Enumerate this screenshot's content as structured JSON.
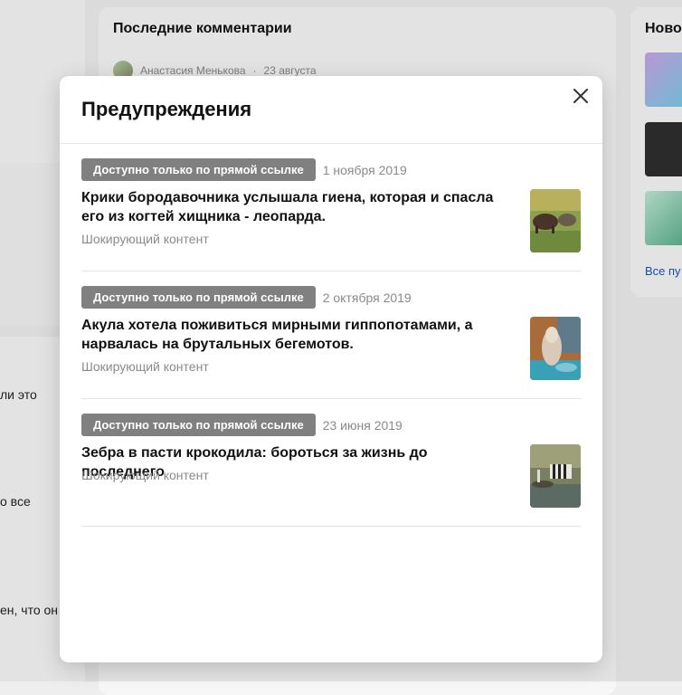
{
  "background": {
    "center_title": "Последние комментарии",
    "comment_author": "Анастасия Менькова",
    "comment_separator": "·",
    "comment_date": "23 августа",
    "right_title": "Ново",
    "right_link": "Все пу",
    "left_fragments": [
      "ли это",
      "о все",
      "ен, что он"
    ]
  },
  "modal": {
    "title": "Предупреждения",
    "close_icon": "close-icon",
    "items": [
      {
        "badge": "Доступно только по прямой ссылке",
        "date": "1 ноября 2019",
        "headline": "Крики бородавочника услышала гиена, которая и спасла его из когтей хищника - леопарда.",
        "category": "Шокирующий контент"
      },
      {
        "badge": "Доступно только по прямой ссылке",
        "date": "2 октября 2019",
        "headline": "Акула хотела поживиться мирными гиппопотамами, а нарвалась на брутальных бегемотов.",
        "category": "Шокирующий контент"
      },
      {
        "badge": "Доступно только по прямой ссылке",
        "date": "23 июня 2019",
        "headline": "Зебра в пасти крокодила: бороться за жизнь до последнего",
        "category": "Шокирующий контент"
      }
    ]
  },
  "colors": {
    "badge_bg": "#808080",
    "meta_text": "#8a8a8a",
    "link": "#1a54b8"
  }
}
